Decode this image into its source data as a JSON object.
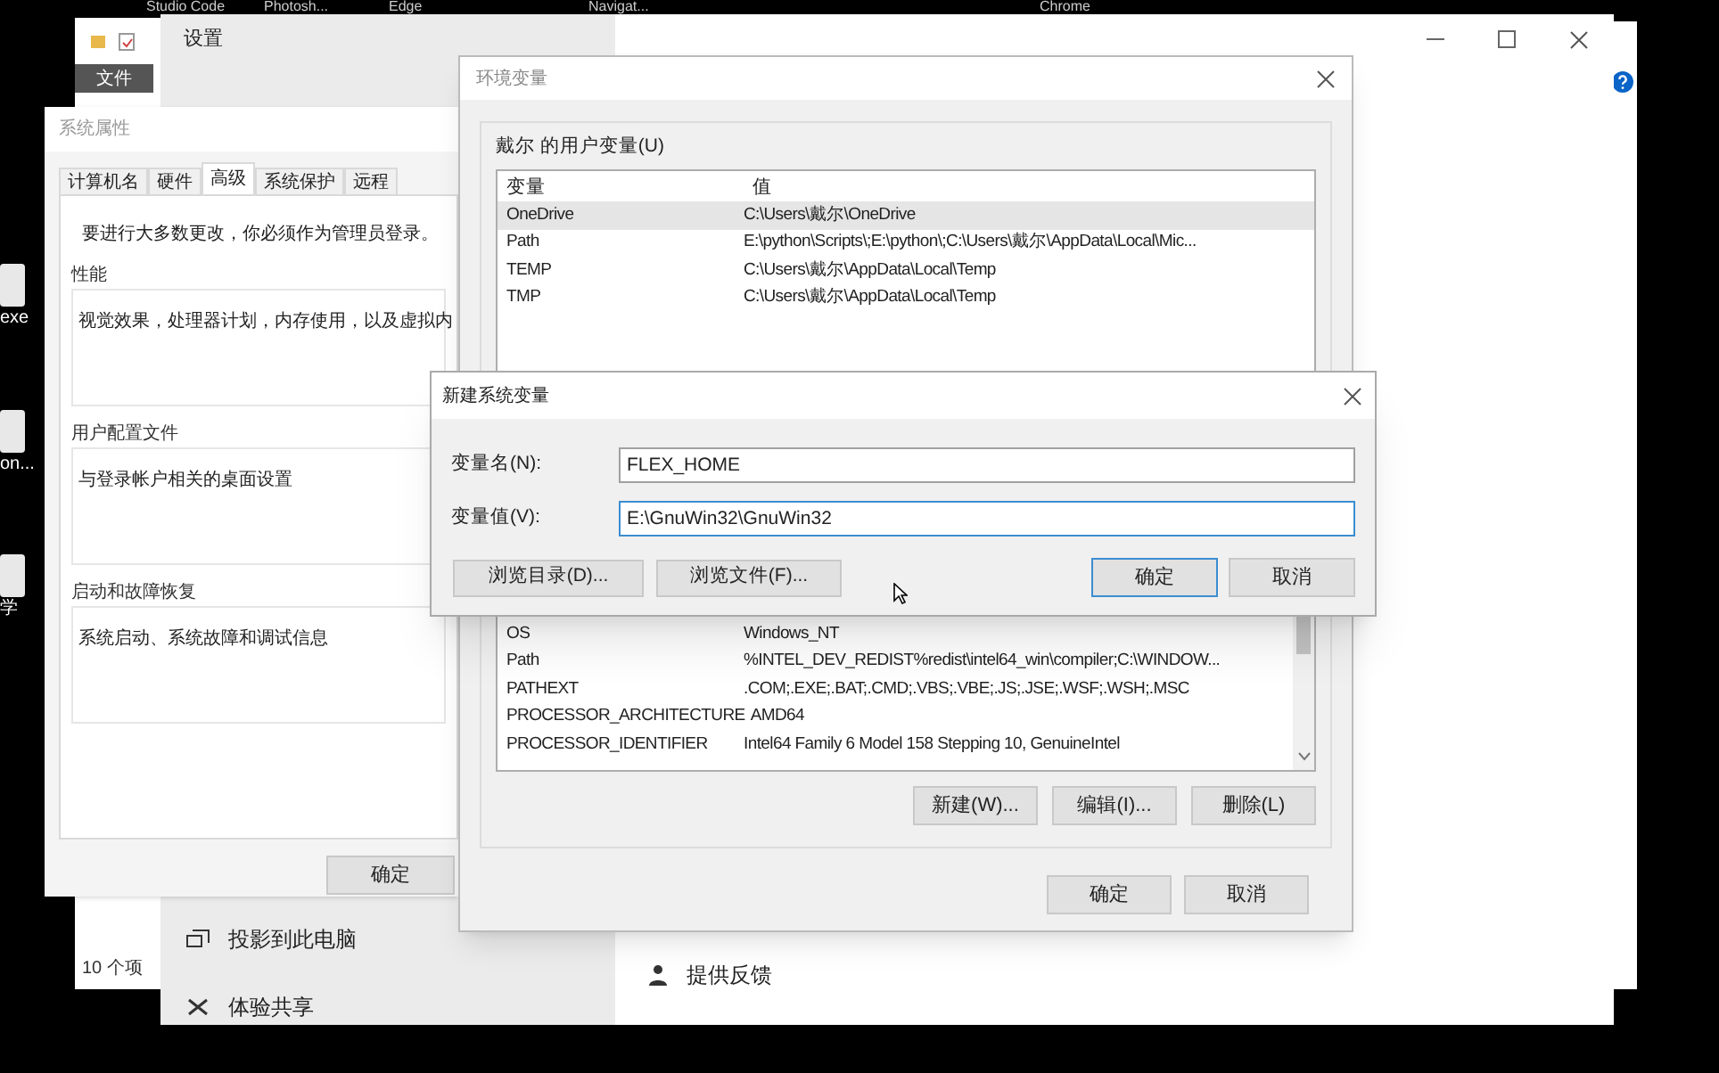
{
  "top_labels": [
    "Studio Code",
    "Photosh...",
    "Edge",
    "Navigat...",
    "Chrome"
  ],
  "desktop_icons": [
    {
      "label": "exe"
    },
    {
      "label": "on..."
    },
    {
      "label": "学"
    }
  ],
  "explorer": {
    "ribbon_tab": "文件",
    "status": "10 个项"
  },
  "settings": {
    "title": "设置",
    "nav": [
      {
        "label": "投影到此电脑"
      },
      {
        "label": "体验共享"
      }
    ],
    "links": [
      {
        "label": "提供反馈"
      }
    ]
  },
  "system_properties": {
    "title": "系统属性",
    "tabs": [
      {
        "label": "计算机名",
        "selected": false
      },
      {
        "label": "硬件",
        "selected": false
      },
      {
        "label": "高级",
        "selected": true
      },
      {
        "label": "系统保护",
        "selected": false
      },
      {
        "label": "远程",
        "selected": false
      }
    ],
    "notice": "要进行大多数更改，你必须作为管理员登录。",
    "groups": [
      {
        "title": "性能",
        "text": "视觉效果，处理器计划，内存使用，以及虚拟内"
      },
      {
        "title": "用户配置文件",
        "text": "与登录帐户相关的桌面设置"
      },
      {
        "title": "启动和故障恢复",
        "text": "系统启动、系统故障和调试信息"
      }
    ],
    "buttons": [
      {
        "label": "确定",
        "default": false
      }
    ]
  },
  "environment_variables": {
    "title": "环境变量",
    "user_label": "戴尔 的用户变量(U)",
    "user_columns": [
      "变量",
      "值"
    ],
    "user_rows": [
      {
        "name": "OneDrive",
        "value": "C:\\Users\\戴尔\\OneDrive",
        "selected": true
      },
      {
        "name": "Path",
        "value": "E:\\python\\Scripts\\;E:\\python\\;C:\\Users\\戴尔\\AppData\\Local\\Mic...",
        "selected": false
      },
      {
        "name": "TEMP",
        "value": "C:\\Users\\戴尔\\AppData\\Local\\Temp",
        "selected": false
      },
      {
        "name": "TMP",
        "value": "C:\\Users\\戴尔\\AppData\\Local\\Temp",
        "selected": false
      }
    ],
    "system_rows": [
      {
        "name": "OS",
        "value": "Windows_NT",
        "selected": false
      },
      {
        "name": "Path",
        "value": "%INTEL_DEV_REDIST%redist\\intel64_win\\compiler;C:\\WINDOW...",
        "selected": false
      },
      {
        "name": "PATHEXT",
        "value": ".COM;.EXE;.BAT;.CMD;.VBS;.VBE;.JS;.JSE;.WSF;.WSH;.MSC",
        "selected": false
      },
      {
        "name": "PROCESSOR_ARCHITECTURE",
        "value": "AMD64",
        "selected": false
      },
      {
        "name": "PROCESSOR_IDENTIFIER",
        "value": "Intel64 Family 6 Model 158 Stepping 10, GenuineIntel",
        "selected": false
      }
    ],
    "system_buttons": [
      "新建(W)...",
      "编辑(I)...",
      "删除(L)"
    ],
    "buttons": [
      {
        "label": "确定",
        "default": false
      },
      {
        "label": "取消",
        "default": false
      }
    ]
  },
  "new_variable_dialog": {
    "title": "新建系统变量",
    "fields": [
      {
        "label": "变量名(N):",
        "value": "FLEX_HOME",
        "focused": false
      },
      {
        "label": "变量值(V):",
        "value": "E:\\GnuWin32\\GnuWin32",
        "focused": true
      }
    ],
    "browse_buttons": [
      "浏览目录(D)...",
      "浏览文件(F)..."
    ],
    "buttons": [
      {
        "label": "确定",
        "default": true
      },
      {
        "label": "取消",
        "default": false
      }
    ]
  }
}
